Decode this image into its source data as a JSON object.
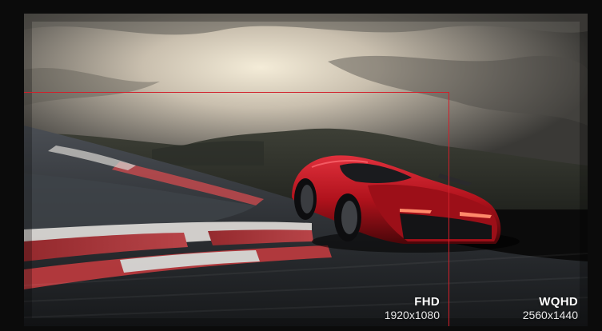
{
  "overlay": {
    "fhd": {
      "name": "FHD",
      "resolution": "1920x1080"
    },
    "wqhd": {
      "name": "WQHD",
      "resolution": "2560x1440"
    },
    "highlight_color": "#d11f2a"
  },
  "image": {
    "subject": "red sports car on race track"
  },
  "colors": {
    "background": "#0b0b0b",
    "car_red": "#b0121c"
  }
}
